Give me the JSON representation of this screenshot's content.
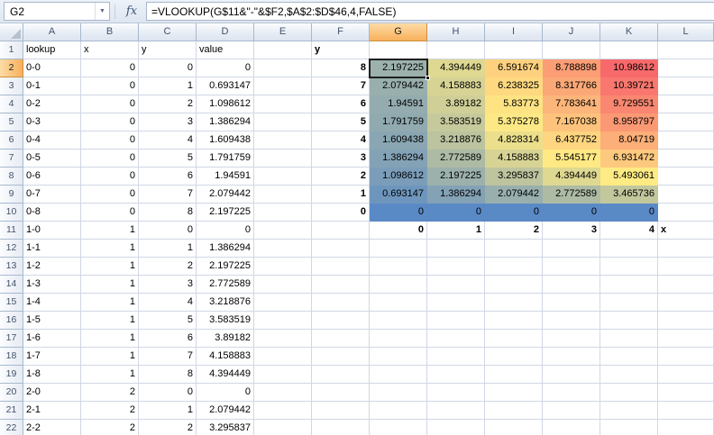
{
  "formula_bar": {
    "name_box": "G2",
    "fx_label": "fx",
    "formula": "=VLOOKUP(G$11&\"-\"&$F2,$A$2:$D$46,4,FALSE)"
  },
  "grid": {
    "columns": [
      "A",
      "B",
      "C",
      "D",
      "E",
      "F",
      "G",
      "H",
      "I",
      "J",
      "K",
      "L"
    ],
    "selection": {
      "cell": "G2",
      "column": "G",
      "row": 2
    },
    "heatmap_scale": {
      "low": "#5A8AC6",
      "mid": "#FFEB84",
      "high": "#F8696B"
    },
    "rows": [
      {
        "n": 1,
        "cells": [
          {
            "c": "A",
            "v": "lookup"
          },
          {
            "c": "B",
            "v": "x"
          },
          {
            "c": "C",
            "v": "y"
          },
          {
            "c": "D",
            "v": "value"
          },
          {
            "c": "F",
            "v": "y",
            "b": 1
          }
        ]
      },
      {
        "n": 2,
        "cells": [
          {
            "c": "A",
            "v": "0-0"
          },
          {
            "c": "B",
            "v": 0
          },
          {
            "c": "C",
            "v": 0
          },
          {
            "c": "D",
            "v": 0
          },
          {
            "c": "F",
            "v": 8,
            "b": 1
          },
          {
            "c": "G",
            "v": 2.197225,
            "bg": "#9CB1AC"
          },
          {
            "c": "H",
            "v": 4.394449,
            "bg": "#DED891"
          },
          {
            "c": "I",
            "v": 6.591674,
            "bg": "#FED17F"
          },
          {
            "c": "J",
            "v": 8.788898,
            "bg": "#FB9D75"
          },
          {
            "c": "K",
            "v": 10.98612,
            "bg": "#F8696B"
          }
        ]
      },
      {
        "n": 3,
        "cells": [
          {
            "c": "A",
            "v": "0-1"
          },
          {
            "c": "B",
            "v": 0
          },
          {
            "c": "C",
            "v": 1
          },
          {
            "c": "D",
            "v": 0.693147
          },
          {
            "c": "F",
            "v": 7,
            "b": 1
          },
          {
            "c": "G",
            "v": 2.079442,
            "bg": "#98AFAD"
          },
          {
            "c": "H",
            "v": 4.158883,
            "bg": "#D7D394"
          },
          {
            "c": "I",
            "v": 6.238325,
            "bg": "#FED980"
          },
          {
            "c": "J",
            "v": 8.317766,
            "bg": "#FBA877"
          },
          {
            "c": "K",
            "v": 10.39721,
            "bg": "#F9776E"
          }
        ]
      },
      {
        "n": 4,
        "cells": [
          {
            "c": "A",
            "v": "0-2"
          },
          {
            "c": "B",
            "v": 0
          },
          {
            "c": "C",
            "v": 2
          },
          {
            "c": "D",
            "v": 1.098612
          },
          {
            "c": "F",
            "v": 6,
            "b": 1
          },
          {
            "c": "G",
            "v": 1.94591,
            "bg": "#94ACAF"
          },
          {
            "c": "H",
            "v": 3.89182,
            "bg": "#CFCF97"
          },
          {
            "c": "I",
            "v": 5.83773,
            "bg": "#FEE382"
          },
          {
            "c": "J",
            "v": 7.783641,
            "bg": "#FCB57A"
          },
          {
            "c": "K",
            "v": 9.729551,
            "bg": "#FA8771"
          }
        ]
      },
      {
        "n": 5,
        "cells": [
          {
            "c": "A",
            "v": "0-3"
          },
          {
            "c": "B",
            "v": 0
          },
          {
            "c": "C",
            "v": 3
          },
          {
            "c": "D",
            "v": 1.386294
          },
          {
            "c": "F",
            "v": 5,
            "b": 1
          },
          {
            "c": "G",
            "v": 1.791759,
            "bg": "#90AAB0"
          },
          {
            "c": "H",
            "v": 3.583519,
            "bg": "#C6C99B"
          },
          {
            "c": "I",
            "v": 5.375278,
            "bg": "#FCE985"
          },
          {
            "c": "J",
            "v": 7.167038,
            "bg": "#FDC37C"
          },
          {
            "c": "K",
            "v": 8.958797,
            "bg": "#FB9974"
          }
        ]
      },
      {
        "n": 6,
        "cells": [
          {
            "c": "A",
            "v": "0-4"
          },
          {
            "c": "B",
            "v": 0
          },
          {
            "c": "C",
            "v": 4
          },
          {
            "c": "D",
            "v": 1.609438
          },
          {
            "c": "F",
            "v": 4,
            "b": 1
          },
          {
            "c": "G",
            "v": 1.609438,
            "bg": "#8AA6B3"
          },
          {
            "c": "H",
            "v": 3.218876,
            "bg": "#BBC39F"
          },
          {
            "c": "I",
            "v": 4.828314,
            "bg": "#EBDF8C"
          },
          {
            "c": "J",
            "v": 6.437752,
            "bg": "#FED580"
          },
          {
            "c": "K",
            "v": 8.04719,
            "bg": "#FCAF78"
          }
        ]
      },
      {
        "n": 7,
        "cells": [
          {
            "c": "A",
            "v": "0-5"
          },
          {
            "c": "B",
            "v": 0
          },
          {
            "c": "C",
            "v": 5
          },
          {
            "c": "D",
            "v": 1.791759
          },
          {
            "c": "F",
            "v": 3,
            "b": 1
          },
          {
            "c": "G",
            "v": 1.386294,
            "bg": "#84A2B5"
          },
          {
            "c": "H",
            "v": 2.772589,
            "bg": "#ADBBA5"
          },
          {
            "c": "I",
            "v": 4.158883,
            "bg": "#D7D394"
          },
          {
            "c": "J",
            "v": 5.545177,
            "bg": "#FFE984"
          },
          {
            "c": "K",
            "v": 6.931472,
            "bg": "#FDC97E"
          }
        ]
      },
      {
        "n": 8,
        "cells": [
          {
            "c": "A",
            "v": "0-6"
          },
          {
            "c": "B",
            "v": 0
          },
          {
            "c": "C",
            "v": 6
          },
          {
            "c": "D",
            "v": 1.94591
          },
          {
            "c": "F",
            "v": 2,
            "b": 1
          },
          {
            "c": "G",
            "v": 1.098612,
            "bg": "#7B9DB9"
          },
          {
            "c": "H",
            "v": 2.197225,
            "bg": "#9CB1AC"
          },
          {
            "c": "I",
            "v": 3.295837,
            "bg": "#BDC49E"
          },
          {
            "c": "J",
            "v": 4.394449,
            "bg": "#DED891"
          },
          {
            "c": "K",
            "v": 5.493061,
            "bg": "#FFEB84"
          }
        ]
      },
      {
        "n": 9,
        "cells": [
          {
            "c": "A",
            "v": "0-7"
          },
          {
            "c": "B",
            "v": 0
          },
          {
            "c": "C",
            "v": 7
          },
          {
            "c": "D",
            "v": 2.079442
          },
          {
            "c": "F",
            "v": 1,
            "b": 1
          },
          {
            "c": "G",
            "v": 0.693147,
            "bg": "#6E96BD"
          },
          {
            "c": "H",
            "v": 1.386294,
            "bg": "#84A2B5"
          },
          {
            "c": "I",
            "v": 2.079442,
            "bg": "#98AFAD"
          },
          {
            "c": "J",
            "v": 2.772589,
            "bg": "#ADBBA5"
          },
          {
            "c": "K",
            "v": 3.465736,
            "bg": "#C2C79C"
          }
        ]
      },
      {
        "n": 10,
        "cells": [
          {
            "c": "A",
            "v": "0-8"
          },
          {
            "c": "B",
            "v": 0
          },
          {
            "c": "C",
            "v": 8
          },
          {
            "c": "D",
            "v": 2.197225
          },
          {
            "c": "F",
            "v": 0,
            "b": 1
          },
          {
            "c": "G",
            "v": 0,
            "bg": "#5A8AC6"
          },
          {
            "c": "H",
            "v": 0,
            "bg": "#5A8AC6"
          },
          {
            "c": "I",
            "v": 0,
            "bg": "#5A8AC6"
          },
          {
            "c": "J",
            "v": 0,
            "bg": "#5A8AC6"
          },
          {
            "c": "K",
            "v": 0,
            "bg": "#5A8AC6"
          }
        ]
      },
      {
        "n": 11,
        "cells": [
          {
            "c": "A",
            "v": "1-0"
          },
          {
            "c": "B",
            "v": 1
          },
          {
            "c": "C",
            "v": 0
          },
          {
            "c": "D",
            "v": 0
          },
          {
            "c": "G",
            "v": 0,
            "b": 1
          },
          {
            "c": "H",
            "v": 1,
            "b": 1
          },
          {
            "c": "I",
            "v": 2,
            "b": 1
          },
          {
            "c": "J",
            "v": 3,
            "b": 1
          },
          {
            "c": "K",
            "v": 4,
            "b": 1
          },
          {
            "c": "L",
            "v": "x",
            "b": 1
          }
        ]
      },
      {
        "n": 12,
        "cells": [
          {
            "c": "A",
            "v": "1-1"
          },
          {
            "c": "B",
            "v": 1
          },
          {
            "c": "C",
            "v": 1
          },
          {
            "c": "D",
            "v": 1.386294
          }
        ]
      },
      {
        "n": 13,
        "cells": [
          {
            "c": "A",
            "v": "1-2"
          },
          {
            "c": "B",
            "v": 1
          },
          {
            "c": "C",
            "v": 2
          },
          {
            "c": "D",
            "v": 2.197225
          }
        ]
      },
      {
        "n": 14,
        "cells": [
          {
            "c": "A",
            "v": "1-3"
          },
          {
            "c": "B",
            "v": 1
          },
          {
            "c": "C",
            "v": 3
          },
          {
            "c": "D",
            "v": 2.772589
          }
        ]
      },
      {
        "n": 15,
        "cells": [
          {
            "c": "A",
            "v": "1-4"
          },
          {
            "c": "B",
            "v": 1
          },
          {
            "c": "C",
            "v": 4
          },
          {
            "c": "D",
            "v": 3.218876
          }
        ]
      },
      {
        "n": 16,
        "cells": [
          {
            "c": "A",
            "v": "1-5"
          },
          {
            "c": "B",
            "v": 1
          },
          {
            "c": "C",
            "v": 5
          },
          {
            "c": "D",
            "v": 3.583519
          }
        ]
      },
      {
        "n": 17,
        "cells": [
          {
            "c": "A",
            "v": "1-6"
          },
          {
            "c": "B",
            "v": 1
          },
          {
            "c": "C",
            "v": 6
          },
          {
            "c": "D",
            "v": 3.89182
          }
        ]
      },
      {
        "n": 18,
        "cells": [
          {
            "c": "A",
            "v": "1-7"
          },
          {
            "c": "B",
            "v": 1
          },
          {
            "c": "C",
            "v": 7
          },
          {
            "c": "D",
            "v": 4.158883
          }
        ]
      },
      {
        "n": 19,
        "cells": [
          {
            "c": "A",
            "v": "1-8"
          },
          {
            "c": "B",
            "v": 1
          },
          {
            "c": "C",
            "v": 8
          },
          {
            "c": "D",
            "v": 4.394449
          }
        ]
      },
      {
        "n": 20,
        "cells": [
          {
            "c": "A",
            "v": "2-0"
          },
          {
            "c": "B",
            "v": 2
          },
          {
            "c": "C",
            "v": 0
          },
          {
            "c": "D",
            "v": 0
          }
        ]
      },
      {
        "n": 21,
        "cells": [
          {
            "c": "A",
            "v": "2-1"
          },
          {
            "c": "B",
            "v": 2
          },
          {
            "c": "C",
            "v": 1
          },
          {
            "c": "D",
            "v": 2.079442
          }
        ]
      },
      {
        "n": 22,
        "cells": [
          {
            "c": "A",
            "v": "2-2"
          },
          {
            "c": "B",
            "v": 2
          },
          {
            "c": "C",
            "v": 2
          },
          {
            "c": "D",
            "v": 3.295837
          }
        ]
      }
    ]
  }
}
